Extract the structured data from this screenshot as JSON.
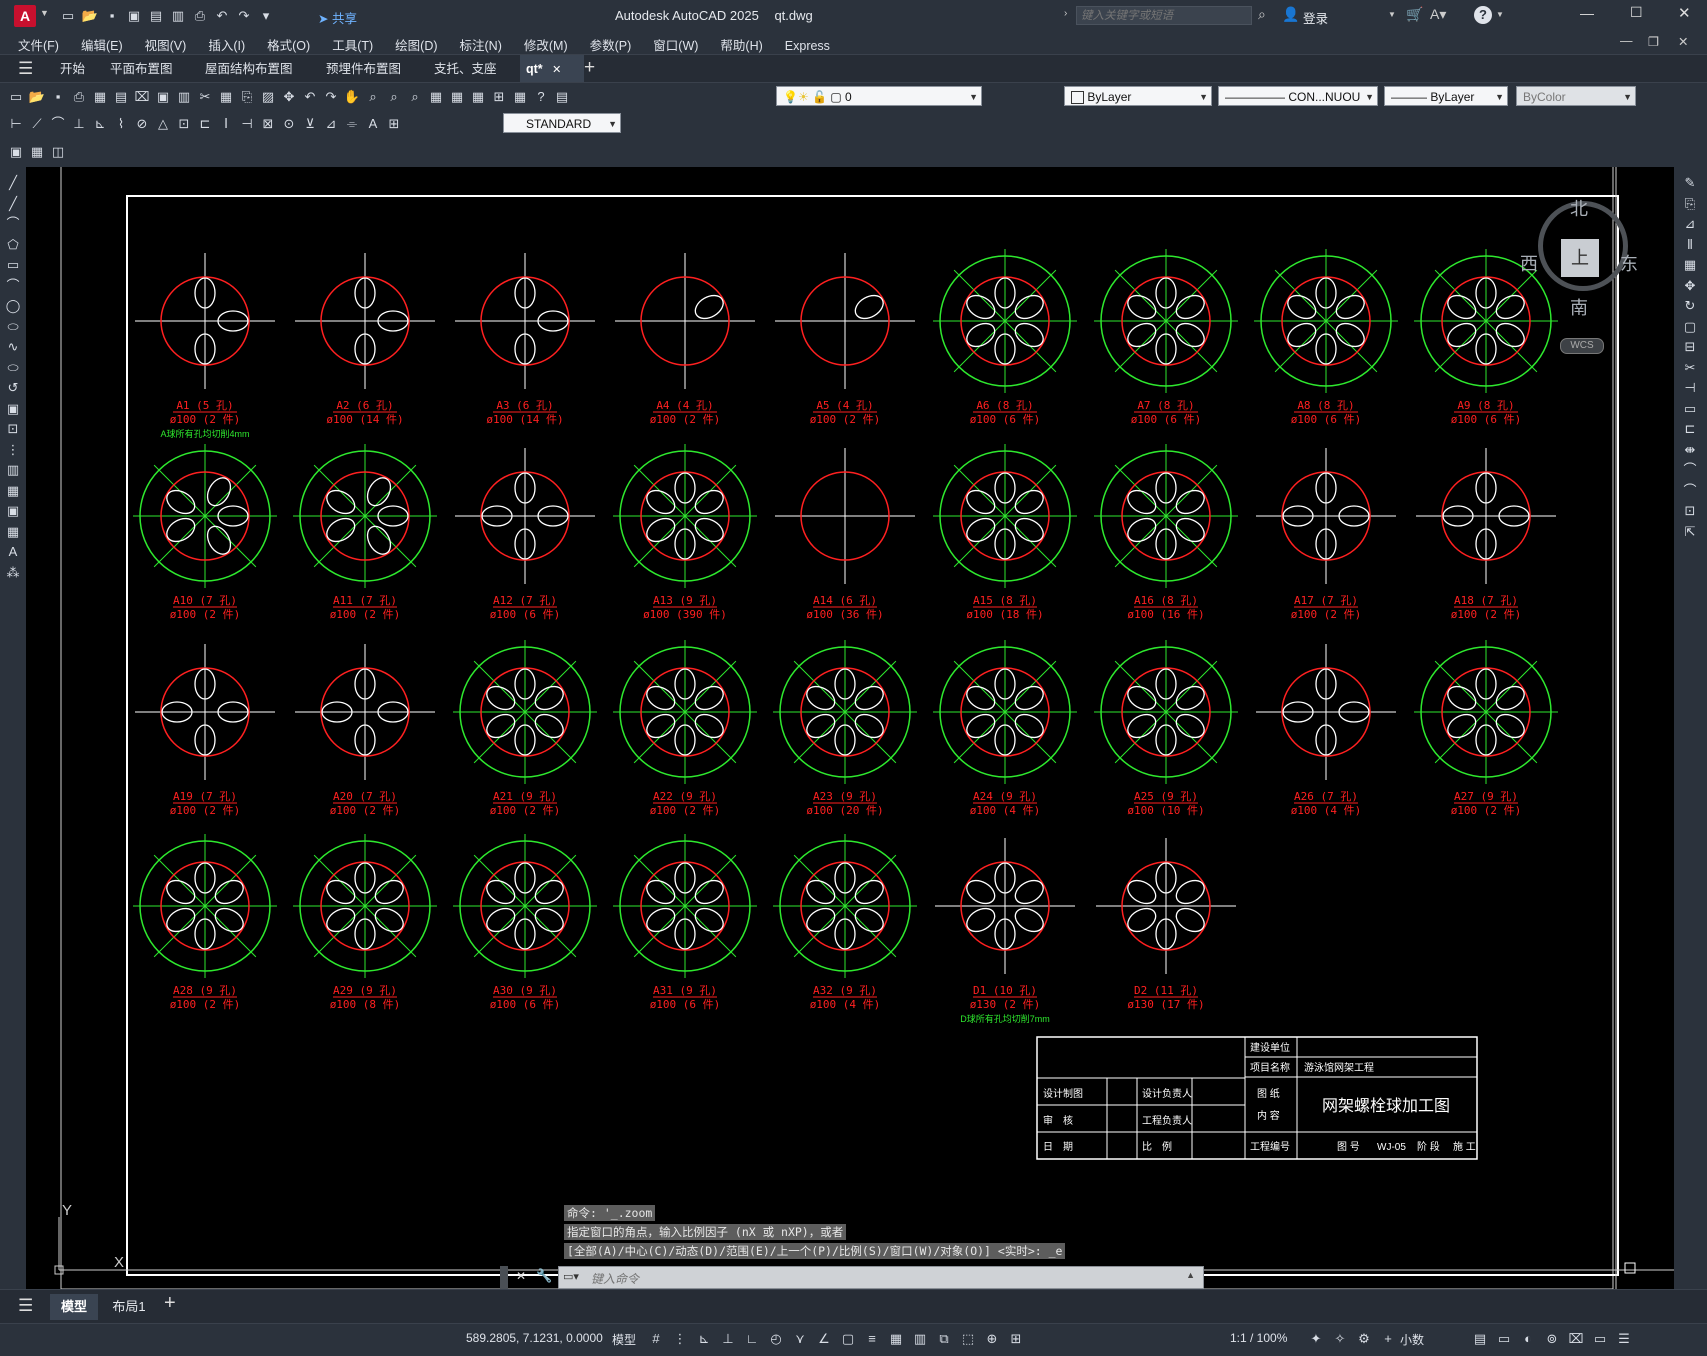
{
  "app": {
    "title": "Autodesk AutoCAD 2025",
    "file": "qt.dwg",
    "share": "共享",
    "search_placeholder": "键入关键字或短语",
    "login": "登录",
    "logo_letter": "A"
  },
  "menu": [
    "文件(F)",
    "编辑(E)",
    "视图(V)",
    "插入(I)",
    "格式(O)",
    "工具(T)",
    "绘图(D)",
    "标注(N)",
    "修改(M)",
    "参数(P)",
    "窗口(W)",
    "帮助(H)",
    "Express"
  ],
  "doc_tabs": [
    "开始",
    "平面布置图",
    "屋面结构布置图",
    "预埋件布置图",
    "支托、支座",
    "qt*"
  ],
  "ribbon": {
    "layer_value": "0",
    "style_value": "STANDARD",
    "color_combo": "ByLayer",
    "linetype_combo": "CON...NUOU",
    "lineweight_combo": "ByLayer",
    "plotstyle_combo": "ByColor"
  },
  "viewcube": {
    "north": "北",
    "south": "南",
    "east": "东",
    "west": "西",
    "top": "上",
    "ucs": "WCS"
  },
  "balls": [
    {
      "name": "A1",
      "holes": "5",
      "qty": "2",
      "note": "A球所有孔均切削4mm",
      "green": false,
      "n": 3
    },
    {
      "name": "A2",
      "holes": "6",
      "qty": "14",
      "green": false,
      "n": 3
    },
    {
      "name": "A3",
      "holes": "6",
      "qty": "14",
      "green": false,
      "n": 3
    },
    {
      "name": "A4",
      "holes": "4",
      "qty": "2",
      "green": false,
      "n": 1
    },
    {
      "name": "A5",
      "holes": "4",
      "qty": "2",
      "green": false,
      "n": 1
    },
    {
      "name": "A6",
      "holes": "8",
      "qty": "6",
      "green": true,
      "n": 6
    },
    {
      "name": "A7",
      "holes": "8",
      "qty": "6",
      "green": true,
      "n": 6
    },
    {
      "name": "A8",
      "holes": "8",
      "qty": "6",
      "green": true,
      "n": 6
    },
    {
      "name": "A9",
      "holes": "8",
      "qty": "6",
      "green": true,
      "n": 6
    },
    {
      "name": "A10",
      "holes": "7",
      "qty": "2",
      "green": true,
      "n": 5
    },
    {
      "name": "A11",
      "holes": "7",
      "qty": "2",
      "green": true,
      "n": 5
    },
    {
      "name": "A12",
      "holes": "7",
      "qty": "6",
      "green": false,
      "n": 4
    },
    {
      "name": "A13",
      "holes": "9",
      "qty": "390",
      "green": true,
      "n": 6
    },
    {
      "name": "A14",
      "holes": "6",
      "qty": "36",
      "green": false,
      "n": 0
    },
    {
      "name": "A15",
      "holes": "8",
      "qty": "18",
      "green": true,
      "n": 6
    },
    {
      "name": "A16",
      "holes": "8",
      "qty": "16",
      "green": true,
      "n": 6
    },
    {
      "name": "A17",
      "holes": "7",
      "qty": "2",
      "green": false,
      "n": 4
    },
    {
      "name": "A18",
      "holes": "7",
      "qty": "2",
      "green": false,
      "n": 4
    },
    {
      "name": "A19",
      "holes": "7",
      "qty": "2",
      "green": false,
      "n": 4
    },
    {
      "name": "A20",
      "holes": "7",
      "qty": "2",
      "green": false,
      "n": 4
    },
    {
      "name": "A21",
      "holes": "9",
      "qty": "2",
      "green": true,
      "n": 6
    },
    {
      "name": "A22",
      "holes": "9",
      "qty": "2",
      "green": true,
      "n": 6
    },
    {
      "name": "A23",
      "holes": "9",
      "qty": "20",
      "green": true,
      "n": 6
    },
    {
      "name": "A24",
      "holes": "9",
      "qty": "4",
      "green": true,
      "n": 6
    },
    {
      "name": "A25",
      "holes": "9",
      "qty": "10",
      "green": true,
      "n": 6
    },
    {
      "name": "A26",
      "holes": "7",
      "qty": "4",
      "green": false,
      "n": 4
    },
    {
      "name": "A27",
      "holes": "9",
      "qty": "2",
      "green": true,
      "n": 6
    },
    {
      "name": "A28",
      "holes": "9",
      "qty": "2",
      "green": true,
      "n": 6
    },
    {
      "name": "A29",
      "holes": "9",
      "qty": "8",
      "green": true,
      "n": 6
    },
    {
      "name": "A30",
      "holes": "9",
      "qty": "6",
      "green": true,
      "n": 6
    },
    {
      "name": "A31",
      "holes": "9",
      "qty": "6",
      "green": true,
      "n": 6
    },
    {
      "name": "A32",
      "holes": "9",
      "qty": "4",
      "green": true,
      "n": 6
    },
    {
      "name": "D1",
      "holes": "10",
      "qty": "2",
      "dia": "130",
      "note": "D球所有孔均切削7mm",
      "green": false,
      "n": 6
    },
    {
      "name": "D2",
      "holes": "11",
      "qty": "17",
      "dia": "130",
      "green": false,
      "n": 6
    }
  ],
  "label_fmt": {
    "hole_unit": "孔",
    "qty_unit": "件",
    "dia_default": "100",
    "dia_prefix": "ø"
  },
  "title_block": {
    "construction_unit": "建设单位",
    "project_name_label": "项目名称",
    "project_name": "游泳馆网架工程",
    "designer": "设计制图",
    "design_lead": "设计负责人",
    "drawing_content": "图 纸\n内 容",
    "drawing_title": "网架螺栓球加工图",
    "reviewer": "审　核",
    "project_lead": "工程负责人",
    "date": "日　期",
    "scale": "比　例",
    "project_no": "工程编号",
    "drawing_no": "图 号",
    "drawing_no_value": "WJ-05",
    "stage": "阶 段",
    "stage_value": "施 工"
  },
  "command": {
    "history": [
      "命令: '_.zoom",
      "指定窗口的角点，输入比例因子 (nX 或 nXP)，或者",
      "[全部(A)/中心(C)/动态(D)/范围(E)/上一个(P)/比例(S)/窗口(W)/对象(O)] <实时>: _e"
    ],
    "placeholder": "键入命令"
  },
  "layout_tabs": [
    "模型",
    "布局1"
  ],
  "status": {
    "coords": "589.2805, 7.1231, 0.0000",
    "mode": "模型",
    "scale": "1:1 / 100%",
    "units": "小数"
  }
}
